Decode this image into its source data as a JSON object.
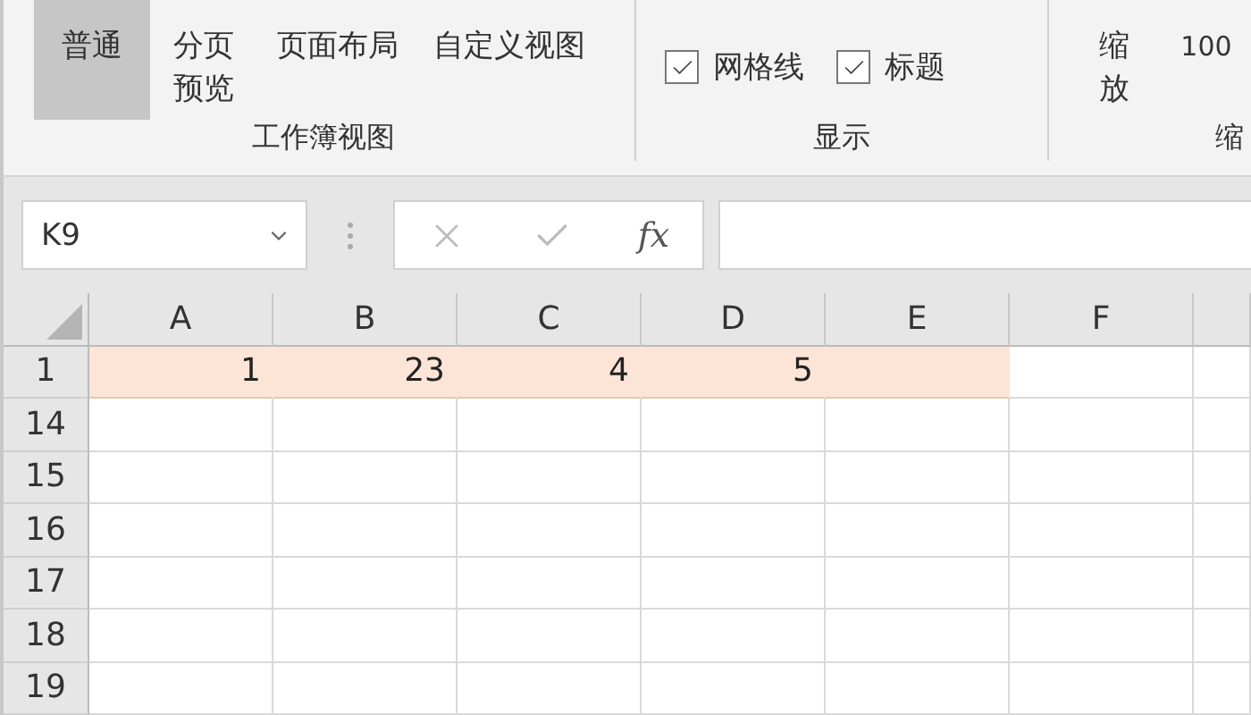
{
  "ribbon": {
    "groups": [
      {
        "kind": "buttons",
        "label": "工作簿视图",
        "buttons": [
          {
            "label": "普通",
            "selected": true
          },
          {
            "label": "分页预览",
            "selected": false
          },
          {
            "label": "页面布局",
            "selected": false
          },
          {
            "label": "自定义视图",
            "selected": false
          }
        ]
      },
      {
        "kind": "checks",
        "label": "显示",
        "checkboxes": [
          {
            "label": "网格线",
            "checked": true
          },
          {
            "label": "标题",
            "checked": true
          }
        ]
      },
      {
        "kind": "zoom",
        "label": "缩",
        "buttons": [
          {
            "label": "缩放",
            "selected": false
          },
          {
            "label": "100",
            "selected": false
          }
        ]
      }
    ]
  },
  "formula_bar": {
    "name_box": "K9",
    "fx": "fx"
  },
  "sheet": {
    "columns": [
      "A",
      "B",
      "C",
      "D",
      "E",
      "F"
    ],
    "rows": [
      {
        "header": "1",
        "cells": [
          {
            "value": "1",
            "highlighted": true
          },
          {
            "value": "23",
            "highlighted": true
          },
          {
            "value": "4",
            "highlighted": true
          },
          {
            "value": "5",
            "highlighted": true
          },
          {
            "highlighted": true
          },
          {
            "highlighted": false
          },
          {
            "highlighted": false
          }
        ]
      },
      {
        "header": "14",
        "cells": [
          {
            "highlighted": false
          },
          {
            "highlighted": false
          },
          {
            "highlighted": false
          },
          {
            "highlighted": false
          },
          {
            "highlighted": false
          },
          {
            "highlighted": false
          },
          {
            "highlighted": false
          }
        ]
      },
      {
        "header": "15",
        "cells": [
          {
            "highlighted": false
          },
          {
            "highlighted": false
          },
          {
            "highlighted": false
          },
          {
            "highlighted": false
          },
          {
            "highlighted": false
          },
          {
            "highlighted": false
          },
          {
            "highlighted": false
          }
        ]
      },
      {
        "header": "16",
        "cells": [
          {
            "highlighted": false
          },
          {
            "highlighted": false
          },
          {
            "highlighted": false
          },
          {
            "highlighted": false
          },
          {
            "highlighted": false
          },
          {
            "highlighted": false
          },
          {
            "highlighted": false
          }
        ]
      },
      {
        "header": "17",
        "cells": [
          {
            "highlighted": false
          },
          {
            "highlighted": false
          },
          {
            "highlighted": false
          },
          {
            "highlighted": false
          },
          {
            "highlighted": false
          },
          {
            "highlighted": false
          },
          {
            "highlighted": false
          }
        ]
      },
      {
        "header": "18",
        "cells": [
          {
            "highlighted": false
          },
          {
            "highlighted": false
          },
          {
            "highlighted": false
          },
          {
            "highlighted": false
          },
          {
            "highlighted": false
          },
          {
            "highlighted": false
          },
          {
            "highlighted": false
          }
        ]
      },
      {
        "header": "19",
        "cells": [
          {
            "highlighted": false
          },
          {
            "highlighted": false
          },
          {
            "highlighted": false
          },
          {
            "highlighted": false
          },
          {
            "highlighted": false
          },
          {
            "highlighted": false
          },
          {
            "highlighted": false
          }
        ]
      }
    ]
  }
}
